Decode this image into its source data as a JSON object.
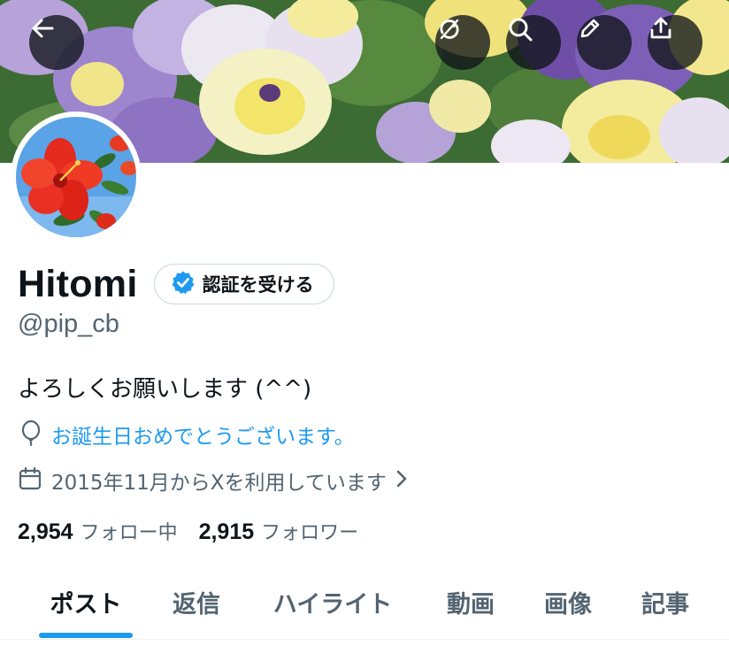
{
  "header": {
    "back_icon": "arrow-left-icon",
    "actions": [
      "refresh-icon",
      "search-icon",
      "edit-icon",
      "share-icon"
    ]
  },
  "profile": {
    "display_name": "Hitomi",
    "verify_label": "認証を受ける",
    "handle": "@pip_cb",
    "bio": "よろしくお願いします (^^)",
    "birthday_text": "お誕生日おめでとうございます。",
    "joined_text": "2015年11月からXを利用しています",
    "following_count": "2,954",
    "following_label": "フォロー中",
    "followers_count": "2,915",
    "followers_label": "フォロワー"
  },
  "tabs": [
    {
      "label": "ポスト",
      "active": true
    },
    {
      "label": "返信",
      "active": false
    },
    {
      "label": "ハイライト",
      "active": false
    },
    {
      "label": "動画",
      "active": false
    },
    {
      "label": "画像",
      "active": false
    },
    {
      "label": "記事",
      "active": false
    }
  ],
  "colors": {
    "accent": "#1d9bf0",
    "text_primary": "#0f1419",
    "text_secondary": "#536471",
    "verified_badge": "#1d9bf0"
  }
}
